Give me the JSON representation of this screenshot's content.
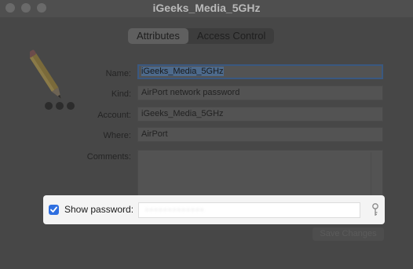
{
  "window": {
    "title": "iGeeks_Media_5GHz"
  },
  "tabs": [
    {
      "label": "Attributes",
      "selected": true
    },
    {
      "label": "Access Control",
      "selected": false
    }
  ],
  "form": {
    "name_label": "Name:",
    "name_value": "iGeeks_Media_5GHz",
    "kind_label": "Kind:",
    "kind_value": "AirPort network password",
    "account_label": "Account:",
    "account_value": "iGeeks_Media_5GHz",
    "where_label": "Where:",
    "where_value": "AirPort",
    "comments_label": "Comments:",
    "comments_value": ""
  },
  "show_password": {
    "label": "Show password:",
    "checked": true,
    "password_hidden": "•••••••••••••"
  },
  "actions": {
    "save_label": "Save Changes"
  },
  "icons": {
    "item": "pencil-icon",
    "key": "key-icon",
    "checkbox": "checkmark-icon"
  },
  "colors": {
    "accent": "#2f6fe0",
    "focus_ring": "#3a5880",
    "panel_bg": "#f4f4f4"
  }
}
